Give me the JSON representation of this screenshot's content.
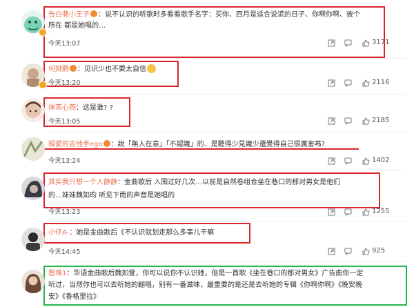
{
  "comments": [
    {
      "username": "告白巷小王子",
      "text_line1": "：说不认识的听歌时多看看歌手名字：买你、四月是适合说谎的日子、你啊你啊、彼个",
      "text_line2": "所在 都是她唱的…",
      "time": "今天13:07",
      "likes": "3171",
      "avatar_color": "#7ad3b4"
    },
    {
      "username": "何拗鹏",
      "text_line1": "：见识少也不要太自信",
      "time": "今天13:20",
      "likes": "2116",
      "avatar_color": "#c9a98b"
    },
    {
      "username": "抹茶心燕",
      "text_line1": "：这是谁? ?",
      "time": "今天13:05",
      "likes": "2185",
      "avatar_color": "#e8c4b2"
    },
    {
      "username": "親愛的吉他手ego",
      "text_line1": "：說「無人在意」「不認識」的、是聽得少見識少還覺得自己很厲害嗎?",
      "time": "今天13:24",
      "likes": "1402",
      "avatar_color": "#cfc8a8"
    },
    {
      "username": "其实我只想一个人静静",
      "text_line1": "：金曲歌后 入围过好几次…以前是自然卷组合坐在巷口的那对男女是他们",
      "text_line2": "的…妹妹魏如昀 听见下雨的声音是她唱的",
      "time": "今天13:23",
      "likes": "1255",
      "avatar_color": "#8e8e96"
    },
    {
      "username": "小仔A-",
      "text_line1": "：她是金曲歌后《不认识就划走那么多事儿干嘛",
      "time": "今天14:45",
      "likes": "925",
      "avatar_color": "#4a4a4a"
    },
    {
      "username": "憨难1",
      "text_line1": "：华语金曲歌后魏如萱，你可以说你不认识她，但是一首歌《坐在巷口的那对男女》广告曲你一定",
      "text_line2": "听过，当然你也可以去听她的翻唱，别有一番滋味，最重要的是还是去听她的专辑《你啊你啊》《晚安晚",
      "text_line3": "安》《香格里拉》",
      "avatar_color": "#8a6a55"
    }
  ],
  "colors": {
    "username": "#eb7350",
    "highlight_red": "#d9252b",
    "highlight_green": "#27b34b",
    "text": "#333333",
    "meta": "#555555"
  },
  "icons": [
    "fan-badge-icon",
    "verified-badge-icon",
    "share-icon",
    "comment-icon",
    "like-icon"
  ]
}
